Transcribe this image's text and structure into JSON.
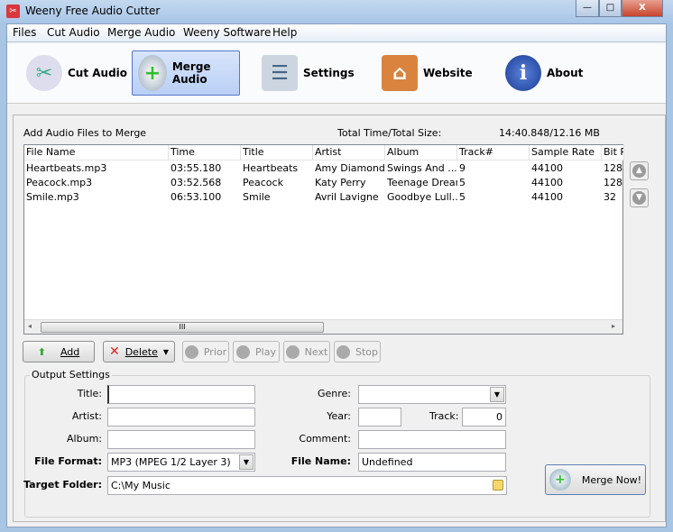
{
  "window": {
    "title": "Weeny Free Audio Cutter",
    "minimize": "—",
    "maximize": "□",
    "close": "X"
  },
  "menu": [
    {
      "label": "Files"
    },
    {
      "label": "Cut Audio"
    },
    {
      "label": "Merge Audio"
    },
    {
      "label": "Weeny Software"
    },
    {
      "label": "Help"
    }
  ],
  "toolbar": [
    {
      "label": "Cut Audio",
      "icon": "scissors-icon"
    },
    {
      "label": "Merge Audio",
      "icon": "cd-plus-icon",
      "active": true
    },
    {
      "label": "Settings",
      "icon": "settings-icon"
    },
    {
      "label": "Website",
      "icon": "house-icon"
    },
    {
      "label": "About",
      "icon": "info-icon"
    }
  ],
  "merge": {
    "heading": "Add Audio Files to Merge",
    "total_label": "Total Time/Total Size:",
    "total_value": "14:40.848/12.16 MB",
    "columns": [
      "File Name",
      "Time",
      "Title",
      "Artist",
      "Album",
      "Track#",
      "Sample Rate",
      "Bit R"
    ],
    "rows": [
      [
        "Heartbeats.mp3",
        "03:55.180",
        "Heartbeats",
        "Amy Diamond",
        "Swings And ...",
        "9",
        "44100",
        "128"
      ],
      [
        "Peacock.mp3",
        "03:52.568",
        "Peacock",
        "Katy Perry",
        "Teenage Dream",
        "5",
        "44100",
        "128"
      ],
      [
        "Smile.mp3",
        "06:53.100",
        "Smile",
        "Avril Lavigne",
        "Goodbye Lull...",
        "5",
        "44100",
        "32"
      ]
    ],
    "scroll_thumb": "III"
  },
  "buttons": {
    "add": "Add",
    "delete": "Delete",
    "prior": "Prior",
    "play": "Play",
    "next": "Next",
    "stop": "Stop",
    "merge_now": "Merge Now!"
  },
  "output": {
    "legend": "Output Settings",
    "title_label": "Title:",
    "title_value": "",
    "artist_label": "Artist:",
    "artist_value": "",
    "album_label": "Album:",
    "album_value": "",
    "format_label": "File Format:",
    "format_value": "MP3 (MPEG 1/2 Layer 3)",
    "folder_label": "Target Folder:",
    "folder_value": "C:\\My Music",
    "genre_label": "Genre:",
    "genre_value": "",
    "year_label": "Year:",
    "year_value": "",
    "track_label": "Track:",
    "track_value": "0",
    "comment_label": "Comment:",
    "comment_value": "",
    "filename_label": "File Name:",
    "filename_value": "Undefined"
  }
}
